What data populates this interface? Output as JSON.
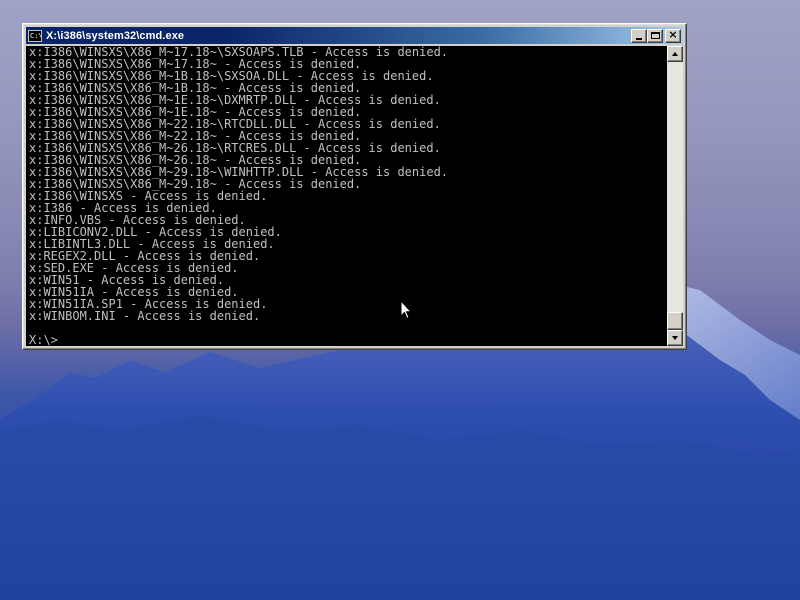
{
  "window": {
    "title": "X:\\i386\\system32\\cmd.exe",
    "app_icon_text": "C:\\",
    "buttons": {
      "minimize": "minimize-icon",
      "maximize": "maximize-icon",
      "close_label": "×"
    }
  },
  "console": {
    "lines": [
      "x:I386\\WINSXS\\X86_M~17.18~\\SXSOAPS.TLB - Access is denied.",
      "x:I386\\WINSXS\\X86_M~17.18~ - Access is denied.",
      "x:I386\\WINSXS\\X86_M~1B.18~\\SXSOA.DLL - Access is denied.",
      "x:I386\\WINSXS\\X86_M~1B.18~ - Access is denied.",
      "x:I386\\WINSXS\\X86_M~1E.18~\\DXMRTP.DLL - Access is denied.",
      "x:I386\\WINSXS\\X86_M~1E.18~ - Access is denied.",
      "x:I386\\WINSXS\\X86_M~22.18~\\RTCDLL.DLL - Access is denied.",
      "x:I386\\WINSXS\\X86_M~22.18~ - Access is denied.",
      "x:I386\\WINSXS\\X86_M~26.18~\\RTCRES.DLL - Access is denied.",
      "x:I386\\WINSXS\\X86_M~26.18~ - Access is denied.",
      "x:I386\\WINSXS\\X86_M~29.18~\\WINHTTP.DLL - Access is denied.",
      "x:I386\\WINSXS\\X86_M~29.18~ - Access is denied.",
      "x:I386\\WINSXS - Access is denied.",
      "x:I386 - Access is denied.",
      "x:INFO.VBS - Access is denied.",
      "x:LIBICONV2.DLL - Access is denied.",
      "x:LIBINTL3.DLL - Access is denied.",
      "x:REGEX2.DLL - Access is denied.",
      "x:SED.EXE - Access is denied.",
      "x:WIN51 - Access is denied.",
      "x:WIN51IA - Access is denied.",
      "x:WIN51IA.SP1 - Access is denied.",
      "x:WINBOM.INI - Access is denied."
    ],
    "prompt": "X:\\>",
    "text_color": "#c0c0c0",
    "background_color": "#000000"
  },
  "scrollbar": {
    "position": 1.0
  },
  "colors": {
    "titlebar_start": "#0a246a",
    "titlebar_end": "#a6caf0",
    "window_face": "#d4d0c8",
    "wallpaper_sky": "#9699bf",
    "wallpaper_mountain": "#2a4aa6"
  },
  "icons": {
    "cursor": "arrow-pointer-icon",
    "scroll_up": "arrow-up-icon",
    "scroll_down": "arrow-down-icon"
  }
}
